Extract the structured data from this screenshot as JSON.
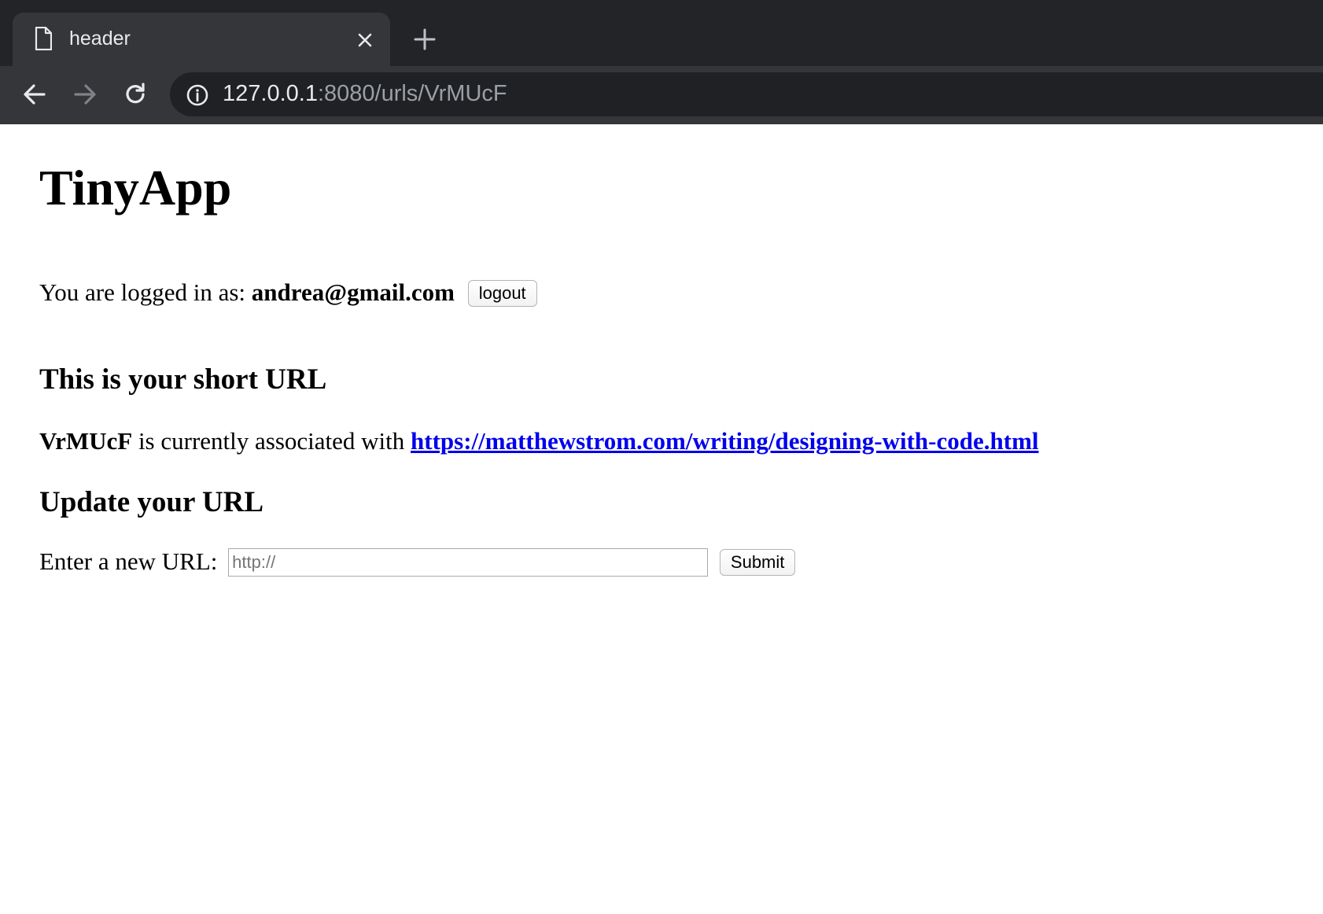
{
  "browser": {
    "tab": {
      "title": "header"
    },
    "address_bar": {
      "host": "127.0.0.1",
      "rest": ":8080/urls/VrMUcF"
    },
    "icons": {
      "page": "page-icon",
      "close": "close-icon",
      "new_tab": "plus-icon",
      "back": "arrow-left-icon",
      "forward": "arrow-right-icon",
      "reload": "reload-icon",
      "info": "info-icon"
    }
  },
  "page": {
    "title": "TinyApp",
    "login": {
      "prefix": "You are logged in as:",
      "email": "andrea@gmail.com",
      "logout_label": "logout"
    },
    "short_url_section": {
      "heading": "This is your short URL",
      "short_id": "VrMUcF",
      "middle_text": " is currently associated with ",
      "long_url": "https://matthewstrom.com/writing/designing-with-code.html"
    },
    "update_section": {
      "heading": "Update your URL",
      "label": "Enter a new URL:",
      "input_value": "",
      "input_placeholder": "http://",
      "submit_label": "Submit"
    }
  },
  "colors": {
    "tab_strip": "#232428",
    "toolbar": "#35363a",
    "omnibox": "#202124",
    "link": "#0000ee"
  }
}
